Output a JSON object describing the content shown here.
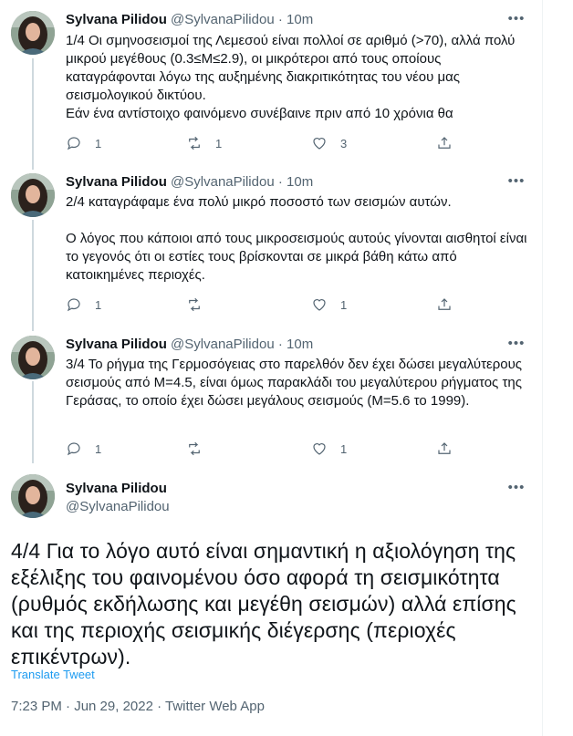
{
  "colors": {
    "link": "#1d9bf0",
    "muted": "#536471",
    "text": "#0f1419",
    "thread": "#cfd9de"
  },
  "author": {
    "name": "Sylvana Pilidou",
    "handle": "@SylvanaPilidou"
  },
  "tweets": [
    {
      "time": "10m",
      "paragraphs": [
        "1/4 Οι σμηνοσεισμοί της Λεμεσού είναι πολλοί σε αριθμό (>70), αλλά πολύ μικρού μεγέθους (0.3≤M≤2.9), οι μικρότεροι από τους οποίους καταγράφονται λόγω της αυξημένης διακριτικότητας του νέου μας σεισμολογικού δικτύου.\nΕάν ένα αντίστοιχο φαινόμενο συνέβαινε πριν από 10 χρόνια θα"
      ],
      "replies": "1",
      "retweets": "1",
      "likes": "3"
    },
    {
      "time": "10m",
      "paragraphs": [
        "2/4 καταγράφαμε ένα πολύ μικρό ποσοστό των σεισμών αυτών.",
        "Ο λόγος που κάποιοι από τους μικροσεισμούς αυτούς γίνονται αισθητοί είναι το γεγονός ότι οι εστίες τους βρίσκονται σε μικρά βάθη κάτω από κατοικημένες περιοχές."
      ],
      "replies": "1",
      "retweets": "",
      "likes": "1"
    },
    {
      "time": "10m",
      "paragraphs": [
        "3/4 Το ρήγμα της Γερμοσόγειας στο παρελθόν δεν έχει δώσει μεγαλύτερους σεισμούς από M=4.5, είναι όμως παρακλάδι του μεγαλύτερου ρήγματος της Γεράσας, το οποίο έχει δώσει μεγάλους σεισμούς (M=5.6 το 1999)."
      ],
      "replies": "1",
      "retweets": "",
      "likes": "1"
    }
  ],
  "main_tweet": {
    "text": "4/4 Για το λόγο αυτό είναι σημαντική η αξιολόγηση της εξέλιξης του φαινομένου όσο αφορά τη σεισμικότητα (ρυθμός εκδήλωσης και μεγέθη σεισμών) αλλά επίσης και της περιοχής σεισμικής διέγερσης (περιοχές επικέντρων).",
    "translate_label": "Translate Tweet",
    "meta": "7:23 PM · Jun 29, 2022 · Twitter Web App"
  },
  "icons": [
    "reply-icon",
    "retweet-icon",
    "like-icon",
    "share-icon",
    "more-icon"
  ]
}
